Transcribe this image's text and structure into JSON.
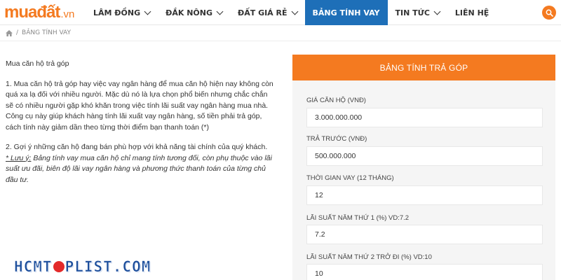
{
  "logo": {
    "brand": "muađất",
    "tld": ".vn"
  },
  "nav": {
    "items": [
      {
        "label": "LÂM ĐỒNG",
        "dropdown": true
      },
      {
        "label": "ĐẮK NÔNG",
        "dropdown": true
      },
      {
        "label": "ĐẤT GIÁ RẺ",
        "dropdown": true
      },
      {
        "label": "BẢNG TÍNH VAY",
        "dropdown": false,
        "active": true
      },
      {
        "label": "TIN TỨC",
        "dropdown": true
      },
      {
        "label": "LIÊN HỆ",
        "dropdown": false
      }
    ]
  },
  "breadcrumb": {
    "sep": "/",
    "current": "BẢNG TÍNH VAY"
  },
  "article": {
    "intro": "Mua căn hộ trả góp",
    "p1": "1. Mua căn hộ trả góp hay việc vay ngân hàng để mua căn hộ hiện nay không còn quá xa lạ đối với nhiều người. Mặc dù nó là lựa chọn phổ biến nhưng chắc chắn sẽ có nhiều người gặp khó khăn trong việc tính lãi suất vay ngân hàng mua nhà. Công cụ này giúp khách hàng tính lãi xuất vay ngân hàng, số tiền phải trả góp, cách tính này giảm dần theo từng thời điểm bạn thanh toán (*)",
    "p2": "2. Gợi ý những căn hộ đang bán phù hợp với khả năng tài chính của quý khách.",
    "note_prefix": "* Lưu ý:",
    "note_plain1": " Bảng tính vay mua căn hộ ",
    "note_em1": "chỉ mang tính tương đối, còn phụ thuộc vào lãi suất ưu đãi, biên độ lãi vay ngân hàng và phương thức thanh toán của từng chủ đầu tư."
  },
  "calculator": {
    "title": "BẢNG TÍNH TRẢ GÓP",
    "fields": [
      {
        "label": "GIÁ CĂN HỘ (VNĐ)",
        "value": "3.000.000.000"
      },
      {
        "label": "TRẢ TRƯỚC (VNĐ)",
        "value": "500.000.000"
      },
      {
        "label": "THỜI GIAN VAY (12 THÁNG)",
        "value": "12"
      },
      {
        "label": "LÃI SUẤT NĂM THỨ 1 (%) VD:7.2",
        "value": "7.2"
      },
      {
        "label": "LÃI SUẤT NĂM THỨ 2 TRỞ ĐI (%) VD:10",
        "value": "10"
      }
    ]
  },
  "watermark": {
    "left": "HCMT",
    "right": "PLIST.COM"
  },
  "icons": {
    "home": "home-icon",
    "search": "search-icon"
  },
  "colors": {
    "accent": "#f47a20",
    "nav_active": "#1e6fb8"
  }
}
